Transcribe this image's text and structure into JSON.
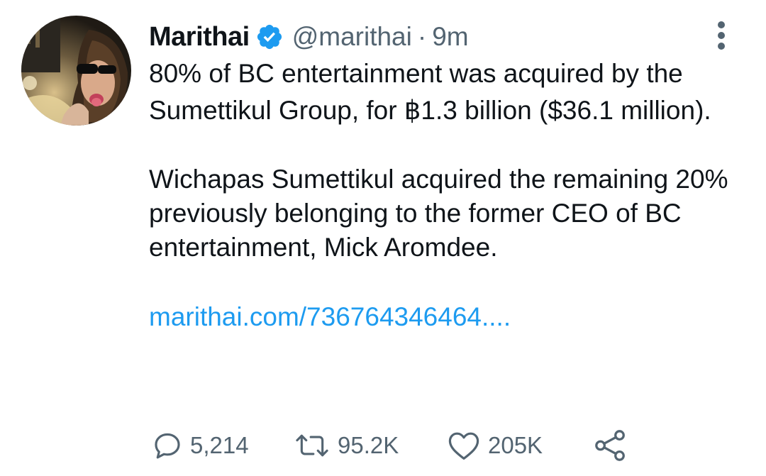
{
  "tweet": {
    "author": {
      "display_name": "Marithai",
      "handle": "@marithai",
      "verified": true,
      "avatar_icon": "profile-photo"
    },
    "separator": "·",
    "time": "9m",
    "text": {
      "paragraph1": "80% of BC entertainment was acquired by the Sumettikul Group, for ฿1.3 billion ($36.1 million).",
      "paragraph2": "Wichapas Sumettikul acquired the remaining 20% previously  belonging to the former CEO of BC entertainment, Mick Aromdee."
    },
    "link": "marithai.com/736764346464....",
    "actions": {
      "reply": {
        "icon": "reply-icon",
        "count": "5,214"
      },
      "retweet": {
        "icon": "retweet-icon",
        "count": "95.2K"
      },
      "like": {
        "icon": "heart-icon",
        "count": "205K"
      },
      "share": {
        "icon": "share-icon"
      }
    },
    "colors": {
      "text": "#0f1419",
      "secondary": "#536471",
      "link": "#1d9bf0",
      "verified": "#1d9bf0"
    }
  }
}
